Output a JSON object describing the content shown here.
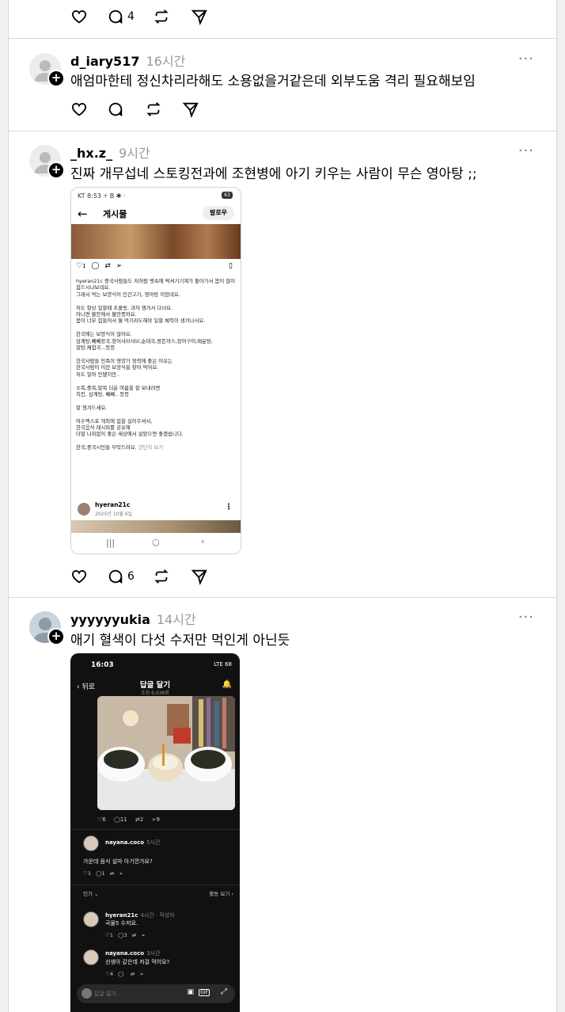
{
  "posts": [
    {
      "comments_count": "4"
    },
    {
      "username": "d_iary517",
      "time": "16시간",
      "text": "애엄마한테 정신차리라해도 소용없을거같은데 외부도움 격리 필요해보임"
    },
    {
      "username": "_hx.z_",
      "time": "9시간",
      "text": "진짜 개무섭네 스토킹전과에 조현병에 아기 키우는 사람이 무슨 영아탕 ;;",
      "comments_count": "6",
      "screenshot": {
        "status": "KT 8:53 ⚡ B ✱ ·",
        "battery": "63",
        "title": "게시물",
        "follow": "팔로우",
        "icon_counts": "1",
        "body": "hyeran21c 중국사람들도 저처럼 뱃속에 떡셔기기계가 돌아가서 몸이 많이 힘드시나보네요.\n그래서 먹는 보양식이 인간고기, 영아탕 이었네요.\n\n저도 항상 일할때 초콜릿, 과자 챙겨서 다녀요.\n아니면 불안해서 불안증와요.\n몸이 너무 힘들어서 뭘 먹기라도해야 일할 체력이 생겨나서요.\n\n한국에는 보양식이 많아요.\n삼계탕,빼빼장국,장어샤브샤브,순대국,왕돈까스,장어구이,매운탕,\n얼탕,채첩국...등등\n\n한국사람들 민족이 영양가 정력에 좋은 이유는\n한국사람이 이런 보양식을 찾아 먹어요.\n저도 얼마 안됐지만..\n\n소복,중복,말복 더운 여름을 잘 보내려면\n치킨, 삼계탕, 빼빼.. 등등\n\n잘 챙겨드세요.\n\n여수엑스포 개최에 힘을 실어주셔서,\n한국음식 레시피를 공유해\n더할 나위없이 좋은 세상에서 살았으면 좋겠습니다.\n\n한국,중국시민들 부탁드려요.",
        "more": "간단히 보기",
        "user": "hyeran21c",
        "date": "2025년 10월 6일"
      }
    },
    {
      "username": "yyyyyyukia",
      "time": "14시간",
      "text": "애기 혈색이 다섯 수저만 먹인게 아닌듯",
      "screenshot": {
        "time": "16:03",
        "signal": "LTE 68",
        "back": "뒤로",
        "title": "답글 달기",
        "subtitle": "조회 6,036회",
        "post_counts": [
          "6",
          "11",
          "2",
          "9"
        ],
        "comments": [
          {
            "name": "nayana.coco",
            "time": "5시간",
            "text": "가운데 음식 설마 아기껀가요?",
            "counts": [
              "1",
              "1"
            ]
          },
          {
            "name": "hyeran21c",
            "time": "4시간 · 작성자",
            "text": "국물5 수저요.",
            "counts": [
              "1",
              "3"
            ]
          },
          {
            "name": "nayana.coco",
            "time": "3시간",
            "text": "선생아 같은데 저걸 먹어요?",
            "counts": [
              "4"
            ]
          }
        ],
        "sort": "인기",
        "view_activity": "활동 보기",
        "reply_placeholder": "답글 달기..."
      }
    }
  ]
}
